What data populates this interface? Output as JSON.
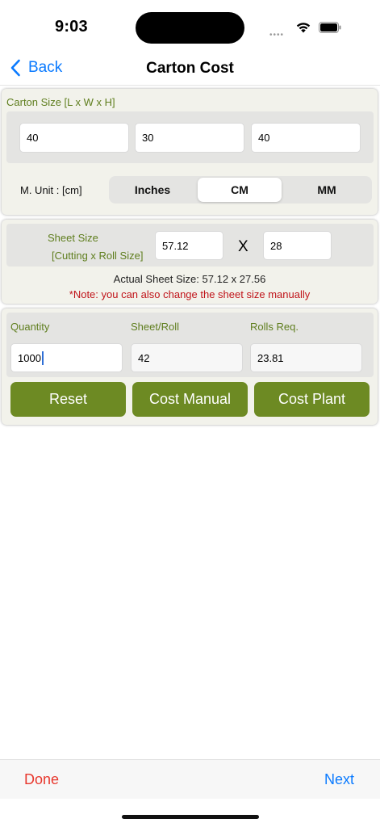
{
  "status": {
    "time": "9:03",
    "dots": "••••"
  },
  "nav": {
    "back_label": "Back",
    "title": "Carton Cost"
  },
  "carton": {
    "label": "Carton Size [L x W x H]",
    "length": "40",
    "width": "30",
    "height": "40",
    "unit_label": "M. Unit : [cm]",
    "units": [
      "Inches",
      "CM",
      "MM"
    ],
    "selected_unit": "CM"
  },
  "sheet": {
    "label_line1": "Sheet Size",
    "label_line2": "[Cutting x Roll Size]",
    "cutting": "57.12",
    "times": "X",
    "roll": "28",
    "actual": "Actual Sheet Size: 57.12 x 27.56",
    "note": "*Note: you can also change the sheet size manually"
  },
  "qty": {
    "quantity_label": "Quantity",
    "sheet_roll_label": "Sheet/Roll",
    "rolls_req_label": "Rolls Req.",
    "quantity": "1000",
    "sheet_roll": "42",
    "rolls_req": "23.81"
  },
  "buttons": {
    "reset": "Reset",
    "cost_manual": "Cost Manual",
    "cost_plant": "Cost Plant"
  },
  "toolbar": {
    "done": "Done",
    "next": "Next"
  },
  "colors": {
    "accent_green": "#6d8a23",
    "label_green": "#5f7e1e",
    "link_blue": "#0a7aff",
    "done_red": "#e8382e",
    "note_red": "#c0141a"
  }
}
